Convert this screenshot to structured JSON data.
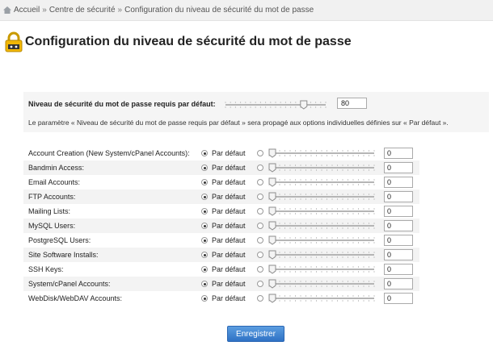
{
  "breadcrumb": {
    "home": "Accueil",
    "separator": "»",
    "security_center": "Centre de sécurité",
    "current": "Configuration du niveau de sécurité du mot de passe"
  },
  "page": {
    "title": "Configuration du niveau de sécurité du mot de passe",
    "icon": "lock-icon"
  },
  "default_setting": {
    "label": "Niveau de sécurité du mot de passe requis par défaut:",
    "value": "80",
    "slider_level": 0.8,
    "description": "Le paramètre « Niveau de sécurité du mot de passe requis par défaut » sera propagé aux options individuelles définies sur « Par défaut »."
  },
  "default_option_label": "Par défaut",
  "accounts": [
    {
      "label": "Account Creation (New System/cPanel Accounts):",
      "value": "0",
      "slider_level": 0,
      "selected": "default"
    },
    {
      "label": "Bandmin Access:",
      "value": "0",
      "slider_level": 0,
      "selected": "default"
    },
    {
      "label": "Email Accounts:",
      "value": "0",
      "slider_level": 0,
      "selected": "default"
    },
    {
      "label": "FTP Accounts:",
      "value": "0",
      "slider_level": 0,
      "selected": "default"
    },
    {
      "label": "Mailing Lists:",
      "value": "0",
      "slider_level": 0,
      "selected": "default"
    },
    {
      "label": "MySQL Users:",
      "value": "0",
      "slider_level": 0,
      "selected": "default"
    },
    {
      "label": "PostgreSQL Users:",
      "value": "0",
      "slider_level": 0,
      "selected": "default"
    },
    {
      "label": "Site Software Installs:",
      "value": "0",
      "slider_level": 0,
      "selected": "default"
    },
    {
      "label": "SSH Keys:",
      "value": "0",
      "slider_level": 0,
      "selected": "default"
    },
    {
      "label": "System/cPanel Accounts:",
      "value": "0",
      "slider_level": 0,
      "selected": "default"
    },
    {
      "label": "WebDisk/WebDAV Accounts:",
      "value": "0",
      "slider_level": 0,
      "selected": "default"
    }
  ],
  "actions": {
    "save_label": "Enregistrer"
  },
  "colors": {
    "accent": "#3a7fd5",
    "panel_bg": "#f5f5f5",
    "lock_yellow": "#f2b705"
  }
}
